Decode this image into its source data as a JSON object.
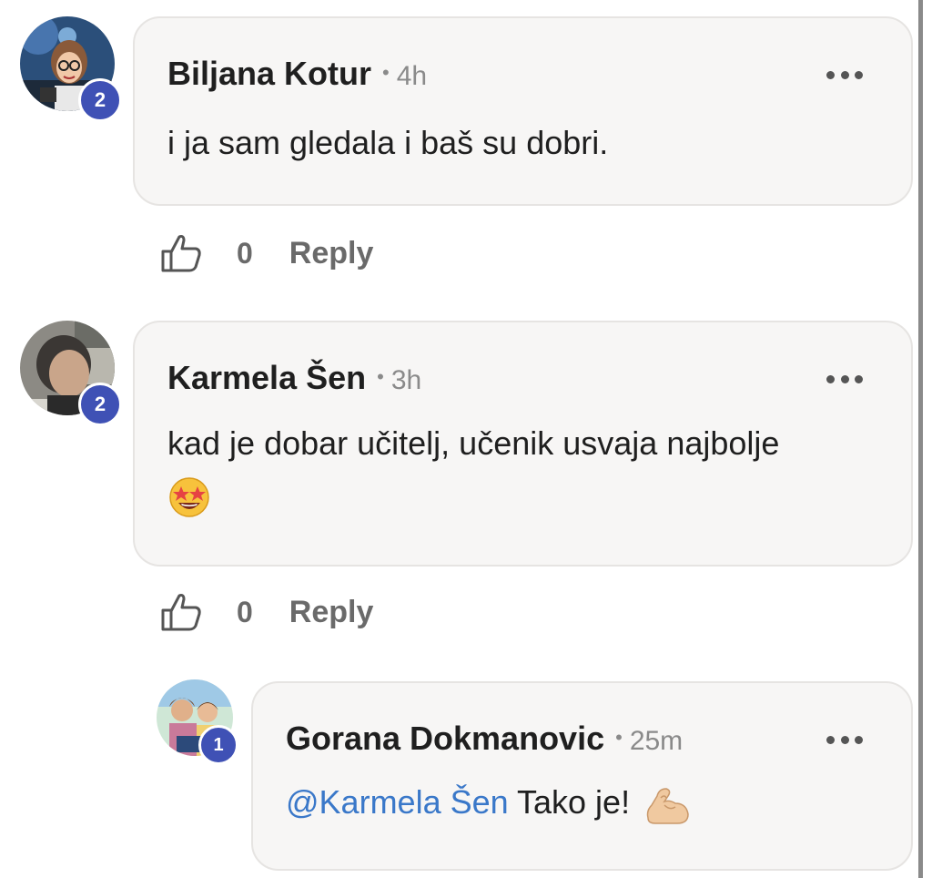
{
  "comments": [
    {
      "author": "Biljana Kotur",
      "time": "4h",
      "badge": "2",
      "text": "i ja sam gledala i baš su dobri.",
      "likes": "0",
      "reply_label": "Reply"
    },
    {
      "author": "Karmela Šen",
      "time": "3h",
      "badge": "2",
      "text": "kad je dobar učitelj, učenik usvaja najbolje",
      "emoji": "star-struck-emoji",
      "likes": "0",
      "reply_label": "Reply"
    },
    {
      "author": "Gorana Dokmanovic",
      "time": "25m",
      "badge": "1",
      "mention": "@Karmela Šen",
      "text": "Tako je!",
      "emoji": "flexed-biceps-emoji"
    }
  ],
  "separator": "•",
  "colors": {
    "badge": "#3f51b5",
    "mention": "#3a78c9",
    "bubble": "#f7f6f5",
    "muted": "#8a8a8a"
  }
}
